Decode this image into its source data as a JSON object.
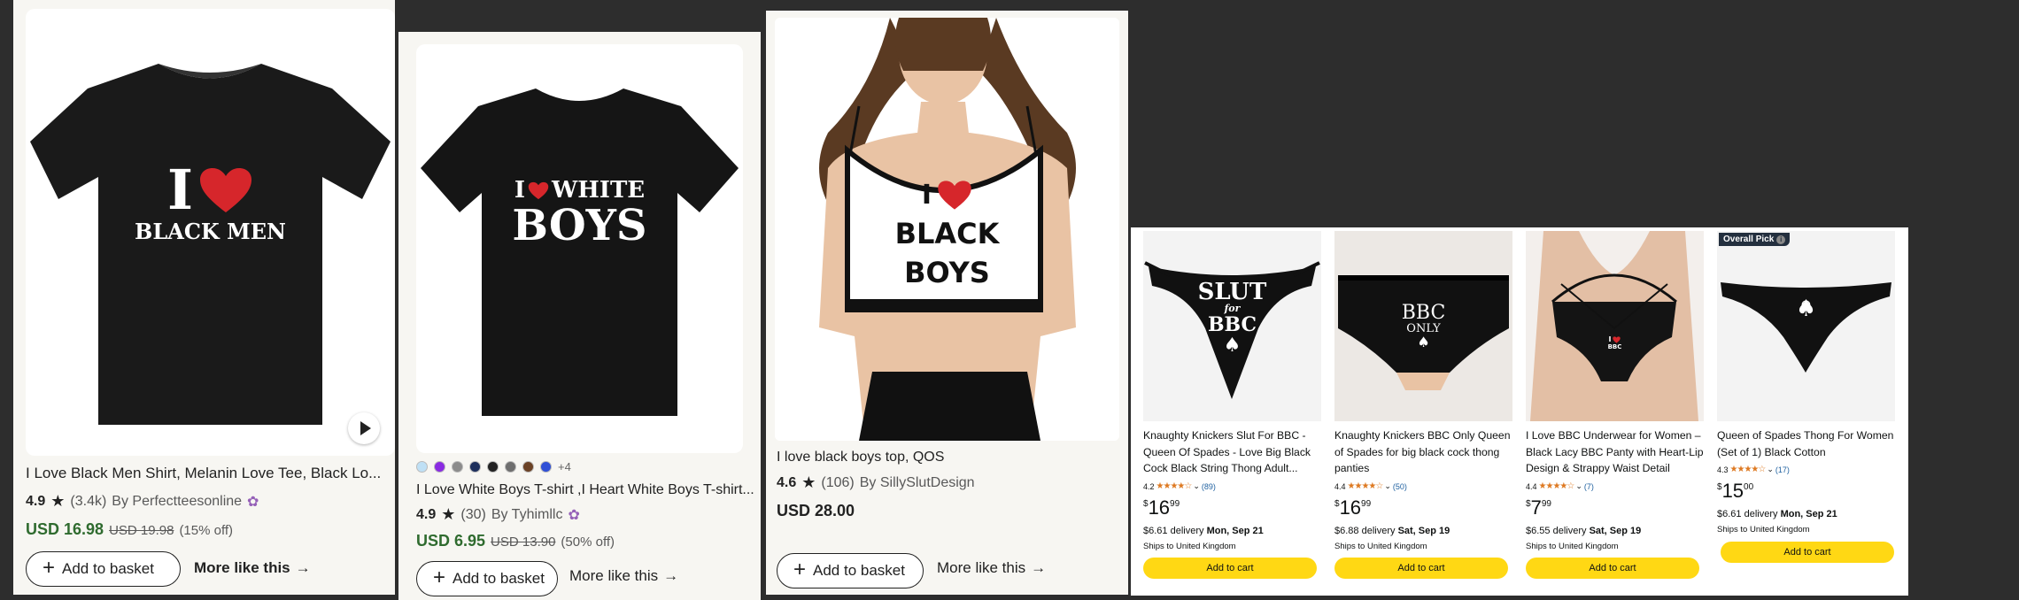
{
  "etsy": {
    "basket_label": "Add to basket",
    "more_like_label": "More like this",
    "items": [
      {
        "title": "I Love Black Men Shirt, Melanin Love Tee, Black Lo...",
        "score": "4.9",
        "count": "(3.4k)",
        "seller": "By Perfectteesonline",
        "price_now": "USD 16.98",
        "price_was": "USD 19.98",
        "discount": "(15% off)",
        "img_line1": "I",
        "img_line2": "BLACK MEN"
      },
      {
        "title": "I Love White Boys T-shirt ,I Heart White Boys T-shirt...",
        "score": "4.9",
        "count": "(30)",
        "seller": "By Tyhimllc",
        "price_now": "USD 6.95",
        "price_was": "USD 13.90",
        "discount": "(50% off)",
        "swatch_more": "+4",
        "swatch_colors": [
          "#bfe0f5",
          "#8a2be2",
          "#8c8c8c",
          "#1d2f5c",
          "#222222",
          "#6e6e6e",
          "#6b4226",
          "#2f4fd6"
        ],
        "img_line1a": "I",
        "img_line1b": "WHITE",
        "img_line2": "BOYS"
      },
      {
        "title": "I love black boys top, QOS",
        "score": "4.6",
        "count": "(106)",
        "seller": "By SillySlutDesign",
        "price_now": "USD 28.00",
        "img_line1": "I",
        "img_line2": "BLACK",
        "img_line3": "BOYS"
      }
    ]
  },
  "amazon": {
    "overall_pick": "Overall Pick",
    "cart_label": "Add to cart",
    "ships": "Ships to United Kingdom",
    "items": [
      {
        "title": "Knaughty Knickers Slut For BBC - Queen Of Spades - Love Big Black Cock Black String Thong Adult...",
        "rating": "4.2",
        "count": "(89)",
        "price_dollars": "16",
        "price_cents": "99",
        "delivery": "$6.61 delivery",
        "delivery_date": "Mon, Sep 21",
        "img_line1": "SLUT",
        "img_line2": "for",
        "img_line3": "BBC",
        "img_letter": "Q"
      },
      {
        "title": "Knaughty Knickers BBC Only Queen of Spades for big black cock thong panties",
        "rating": "4.4",
        "count": "(50)",
        "price_dollars": "16",
        "price_cents": "99",
        "delivery": "$6.88 delivery",
        "delivery_date": "Sat, Sep 19",
        "img_line1": "BBC",
        "img_line2": "ONLY",
        "img_letter": "Q"
      },
      {
        "title": "I Love BBC Underwear for Women – Black Lacy BBC Panty with Heart-Lip Design & Strappy Waist Detail",
        "rating": "4.4",
        "count": "(7)",
        "price_dollars": "7",
        "price_cents": "99",
        "delivery": "$6.55 delivery",
        "delivery_date": "Sat, Sep 19",
        "img_line1": "I",
        "img_line2": "BBC"
      },
      {
        "title": "Queen of Spades Thong For Women (Set of 1) Black Cotton",
        "rating": "4.3",
        "count": "(17)",
        "price_dollars": "15",
        "price_cents": "00",
        "delivery": "$6.61 delivery",
        "delivery_date": "Mon, Sep 21",
        "img_letter": "Q"
      }
    ]
  },
  "colors": {
    "etsy_green": "#2f6b2f",
    "amazon_yellow": "#ffd814",
    "heart_red": "#d6262b",
    "rating_orange": "#de7921",
    "link_blue": "#2162a1"
  }
}
